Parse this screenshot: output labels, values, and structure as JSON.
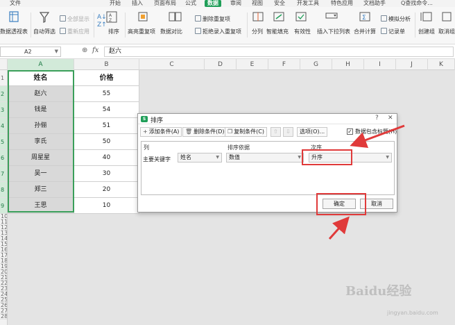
{
  "menu": {
    "file": "文件",
    "tabs": [
      "开始",
      "插入",
      "页面布局",
      "公式",
      "数据",
      "审阅",
      "视图",
      "安全",
      "开发工具",
      "特色应用",
      "文档助手"
    ],
    "active_tab": "数据",
    "search": "Q查找命令..."
  },
  "ribbon": {
    "pivot": "数据透视表",
    "autofilter": "自动筛选",
    "show_all": "全部显示",
    "reapply": "重新应用",
    "sort_label": "排序",
    "highlight_dup": "高亮重复项",
    "data_compare": "数据对比",
    "remove_dup": "删除重复项",
    "reject_dup": "拒绝录入重复项",
    "split": "分列",
    "smart_fill": "智能填充",
    "validity": "有效性",
    "insert_dropdown": "插入下拉列表",
    "merge_calc": "合并计算",
    "simulate": "模拟分析",
    "record_sheet": "记录单",
    "create_group": "创建组",
    "ungroup": "取消组"
  },
  "formula_bar": {
    "cell_ref": "A2",
    "fx": "fx",
    "value": "赵六"
  },
  "columns": [
    "A",
    "B",
    "C",
    "D",
    "E",
    "F",
    "G",
    "H",
    "I",
    "J",
    "K"
  ],
  "rows": [
    "1",
    "2",
    "3",
    "4",
    "5",
    "6",
    "7",
    "8",
    "9",
    "10",
    "11",
    "12",
    "13",
    "14",
    "15",
    "16",
    "17",
    "18",
    "19",
    "20",
    "21",
    "22",
    "23",
    "24",
    "25",
    "26",
    "27",
    "28"
  ],
  "table": {
    "headers": [
      "姓名",
      "价格"
    ],
    "rows": [
      [
        "赵六",
        "55"
      ],
      [
        "钱是",
        "54"
      ],
      [
        "孙俪",
        "51"
      ],
      [
        "李氏",
        "50"
      ],
      [
        "周星星",
        "40"
      ],
      [
        "吴一",
        "30"
      ],
      [
        "郑三",
        "20"
      ],
      [
        "王思",
        "10"
      ]
    ]
  },
  "dialog": {
    "title": "排序",
    "add_condition": "添加条件(A)",
    "delete_condition": "删除条件(D)",
    "copy_condition": "复制条件(C)",
    "options": "选项(O)...",
    "has_header": "数据包含标题(H)",
    "col_header": "列",
    "sort_basis_header": "排序依据",
    "order_header": "次序",
    "primary_key": "主要关键字",
    "key_value": "姓名",
    "basis_value": "数值",
    "order_value": "升序",
    "ok": "确定",
    "cancel": "取消"
  },
  "watermark": {
    "brand": "Baidu经验",
    "url": "jingyan.baidu.com"
  },
  "colors": {
    "accent_green": "#1f9e58",
    "annotation_red": "#e03a3a"
  }
}
